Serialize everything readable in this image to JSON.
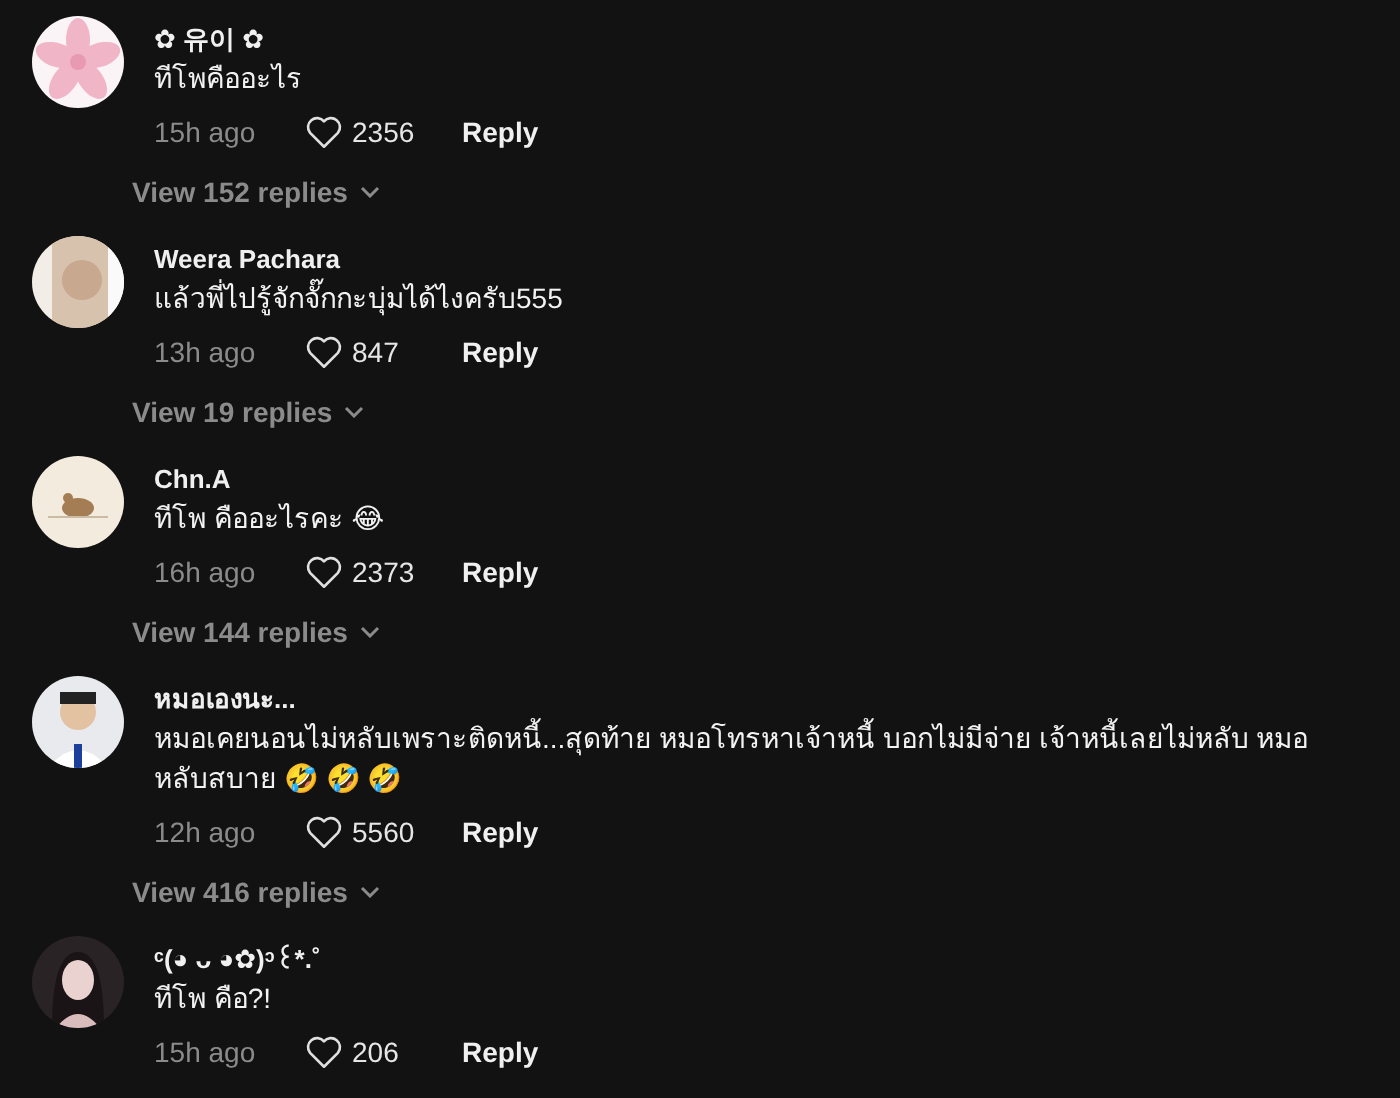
{
  "comments": [
    {
      "author": "✿ 유이 ✿",
      "text": "ทีโพคืออะไร",
      "time": "15h ago",
      "likes": "2356",
      "reply": "Reply",
      "view_replies": "View 152 replies"
    },
    {
      "author": "Weera Pachara",
      "text": "แล้วพี่ไปรู้จักจั๊กกะบุ่มได้ไงครับ555",
      "time": "13h ago",
      "likes": "847",
      "reply": "Reply",
      "view_replies": "View 19 replies"
    },
    {
      "author": "Chn.A",
      "text": "ทีโพ คืออะไรคะ 😂",
      "time": "16h ago",
      "likes": "2373",
      "reply": "Reply",
      "view_replies": "View 144 replies"
    },
    {
      "author": "หมอเองนะ...",
      "text": "หมอเคยนอนไม่หลับเพราะติดหนี้...สุดท้าย หมอโทรหาเจ้าหนี้ บอกไม่มีจ่าย เจ้าหนี้เลยไม่หลับ หมอหลับสบาย 🤣 🤣 🤣",
      "time": "12h ago",
      "likes": "5560",
      "reply": "Reply",
      "view_replies": "View 416 replies"
    },
    {
      "author": "ᶜ(◕ ᴗ ◕✿)ᵓ꒰*.˚",
      "text": "ทีโพ คือ?!",
      "time": "15h ago",
      "likes": "206",
      "reply": "Reply"
    }
  ]
}
